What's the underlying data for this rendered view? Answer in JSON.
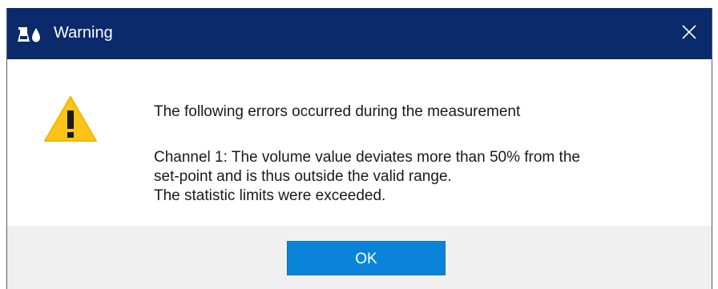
{
  "window": {
    "title": "Warning",
    "app_icon": "flask-drop-icon",
    "close_icon": "close-icon",
    "titlebar_color": "#0b2a6b"
  },
  "message": {
    "icon": "warning-icon",
    "headline": "The following errors occurred during the measurement",
    "detail_lines": [
      "Channel 1: The volume value deviates more than 50% from the",
      "set-point and is thus outside the valid range.",
      "The statistic limits were exceeded."
    ]
  },
  "buttons": {
    "ok_label": "OK",
    "ok_color": "#0a84d8"
  }
}
